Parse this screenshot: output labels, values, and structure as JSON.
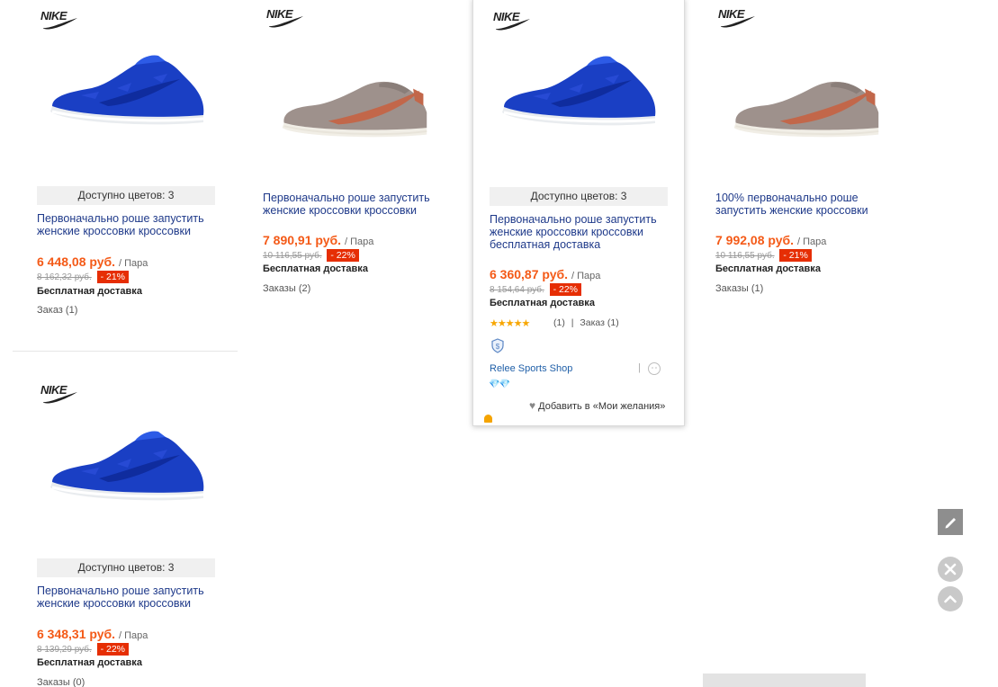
{
  "brand": "NIKE",
  "products": [
    {
      "colors_available": "Доступно цветов: 3",
      "title": "Первоначально роше запустить женские кроссовки кроссовки",
      "price": "6 448,08 руб.",
      "unit": "/ Пара",
      "old_price": "8 162,32 руб.",
      "discount": "- 21%",
      "delivery": "Бесплатная доставка",
      "orders": "Заказ (1)"
    },
    {
      "title": "Первоначально роше запустить женские кроссовки кроссовки",
      "price": "7 890,91 руб.",
      "unit": "/ Пара",
      "old_price": "10 116,55 руб.",
      "discount": "- 22%",
      "delivery": "Бесплатная доставка",
      "orders": "Заказы (2)"
    },
    {
      "colors_available": "Доступно цветов: 3",
      "title": "Первоначально роше запустить женские кроссовки кроссовки бесплатная доставка",
      "price": "6 360,87 руб.",
      "unit": "/ Пара",
      "old_price": "8 154,64 руб.",
      "discount": "- 22%",
      "delivery": "Бесплатная доставка",
      "rating_stars": "★★★★★",
      "rating_count": "(1)",
      "divider": "|",
      "orders": "Заказ (1)",
      "store": "Relee Sports Shop",
      "store_divider": "|",
      "store_level": "💎💎",
      "wishlist": "Добавить в «Мои желания»"
    },
    {
      "title": "100% первоначально роше запустить женские кроссовки",
      "price": "7 992,08 руб.",
      "unit": "/ Пара",
      "old_price": "10 116,55 руб.",
      "discount": "- 21%",
      "delivery": "Бесплатная доставка",
      "orders": "Заказы (1)"
    },
    {
      "colors_available": "Доступно цветов: 3",
      "title": "Первоначально роше запустить женские кроссовки кроссовки",
      "price": "6 348,31 руб.",
      "unit": "/ Пара",
      "old_price": "8 139,29 руб.",
      "discount": "- 22%",
      "delivery": "Бесплатная доставка",
      "orders": "Заказы (0)"
    }
  ],
  "colors": {
    "price": "#f45a17",
    "discount_bg": "#e62e04",
    "title": "#1f3a8a",
    "shoe_blue": "#1a3fc4",
    "shoe_grey": "#9e918c",
    "swoosh_copper": "#c2674a"
  },
  "tools": {
    "edit_icon": "pencil-icon",
    "close_icon": "close-icon",
    "top_icon": "chevron-up-icon"
  }
}
